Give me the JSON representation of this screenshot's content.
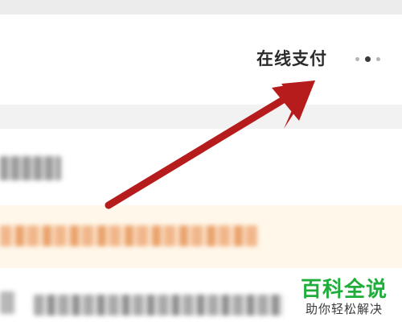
{
  "header": {
    "action_label": "在线支付",
    "more_icon": "more-dots-icon"
  },
  "annotation": {
    "arrow_color": "#b71c1c"
  },
  "watermark": {
    "title": "百科全说",
    "subtitle": "助你轻松解决",
    "title_color": "#1fae3a"
  },
  "colors": {
    "top_strip": "#ececec",
    "divider": "#f2f2f2",
    "notice_bg": "#fff7ea"
  }
}
